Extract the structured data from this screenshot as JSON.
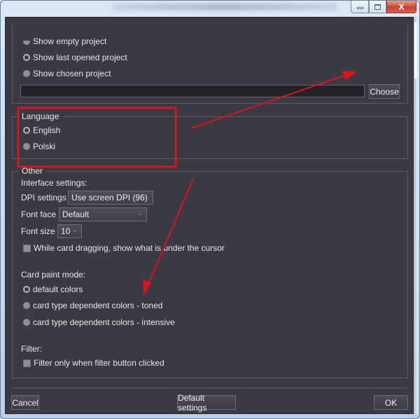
{
  "window": {
    "controls": {
      "minimize_icon": "minimize-icon",
      "maximize_icon": "restore-icon",
      "close_label": "X"
    }
  },
  "startup": {
    "options": [
      {
        "label": "Show empty project",
        "selected": false
      },
      {
        "label": "Show last opened project",
        "selected": true
      },
      {
        "label": "Show chosen project",
        "selected": false
      }
    ],
    "project_path": "",
    "choose_button": "Choose"
  },
  "language": {
    "legend": "Language",
    "options": [
      {
        "label": "English",
        "selected": true
      },
      {
        "label": "Polski",
        "selected": false
      }
    ]
  },
  "other": {
    "legend": "Other",
    "interface_settings_label": "Interface settings:",
    "dpi": {
      "label": "DPI settings",
      "value": "Use screen DPI (96)"
    },
    "font_face": {
      "label": "Font face",
      "value": "Default"
    },
    "font_size": {
      "label": "Font size",
      "value": "10"
    },
    "drag_checkbox": {
      "label": "While card dragging, show what is under the cursor",
      "checked": false
    },
    "card_paint_mode_label": "Card paint mode:",
    "paint_modes": [
      {
        "label": "default colors",
        "selected": true
      },
      {
        "label": "card type dependent colors - toned",
        "selected": false
      },
      {
        "label": "card type dependent colors - intensive",
        "selected": false
      }
    ],
    "filter_label": "Filter:",
    "filter_checkbox": {
      "label": "Filter only when filter button clicked",
      "checked": false
    }
  },
  "footer": {
    "cancel": "Cancel",
    "default_settings": "Default settings",
    "ok": "OK"
  },
  "annotations": {
    "color": "#d8141c"
  }
}
